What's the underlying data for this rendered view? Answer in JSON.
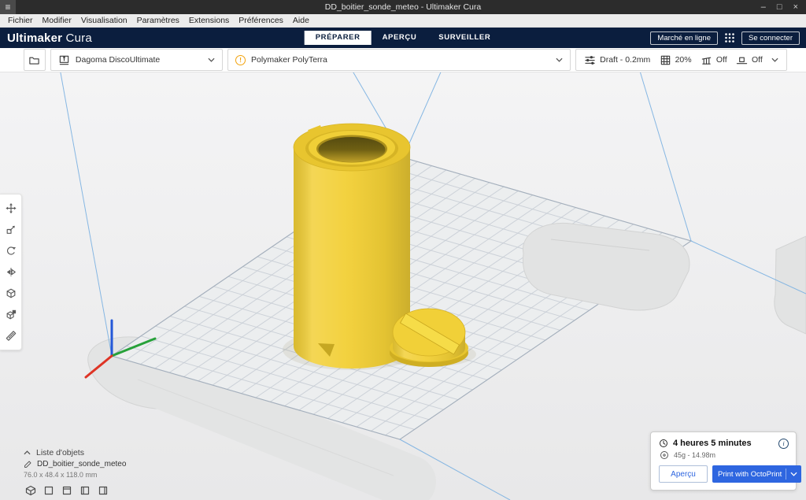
{
  "window": {
    "title": "DD_boitier_sonde_meteo - Ultimaker Cura"
  },
  "menu_bar": {
    "items": [
      "Fichier",
      "Modifier",
      "Visualisation",
      "Paramètres",
      "Extensions",
      "Préférences",
      "Aide"
    ]
  },
  "header": {
    "brand_bold": "Ultimaker",
    "brand_light": "Cura",
    "tabs": [
      {
        "label": "PRÉPARER",
        "active": true
      },
      {
        "label": "APERÇU",
        "active": false
      },
      {
        "label": "SURVEILLER",
        "active": false
      }
    ],
    "marketplace_label": "Marché en ligne",
    "sign_in_label": "Se connecter"
  },
  "config_bar": {
    "printer": {
      "name": "Dagoma DiscoUltimate"
    },
    "material": {
      "name": "Polymaker PolyTerra"
    },
    "print_settings": {
      "profile": "Draft - 0.2mm",
      "infill": "20%",
      "support": "Off",
      "adhesion": "Off"
    }
  },
  "tools": [
    {
      "name": "move"
    },
    {
      "name": "scale"
    },
    {
      "name": "rotate"
    },
    {
      "name": "mirror"
    },
    {
      "name": "per-model-settings"
    },
    {
      "name": "support-blocker"
    },
    {
      "name": "measure"
    }
  ],
  "object_list": {
    "header": "Liste d'objets",
    "items": [
      {
        "name": "DD_boitier_sonde_meteo"
      }
    ],
    "selected_dimensions": "76.0 x 48.4 x 118.0 mm"
  },
  "print_panel": {
    "time": "4 heures 5 minutes",
    "material_usage": "45g - 14.98m",
    "preview_label": "Aperçu",
    "print_label": "Print with OctoPrint"
  },
  "icons": {
    "hamburger_glyph": "≡",
    "minimize_glyph": "–",
    "maximize_glyph": "□",
    "close_glyph": "×",
    "warning_glyph": "!",
    "info_glyph": "i"
  },
  "colors": {
    "accent": "#2e66e0",
    "header-navy": "#0b1e3e",
    "model-yellow": "#f2cf35",
    "warning": "#f2a20c"
  }
}
